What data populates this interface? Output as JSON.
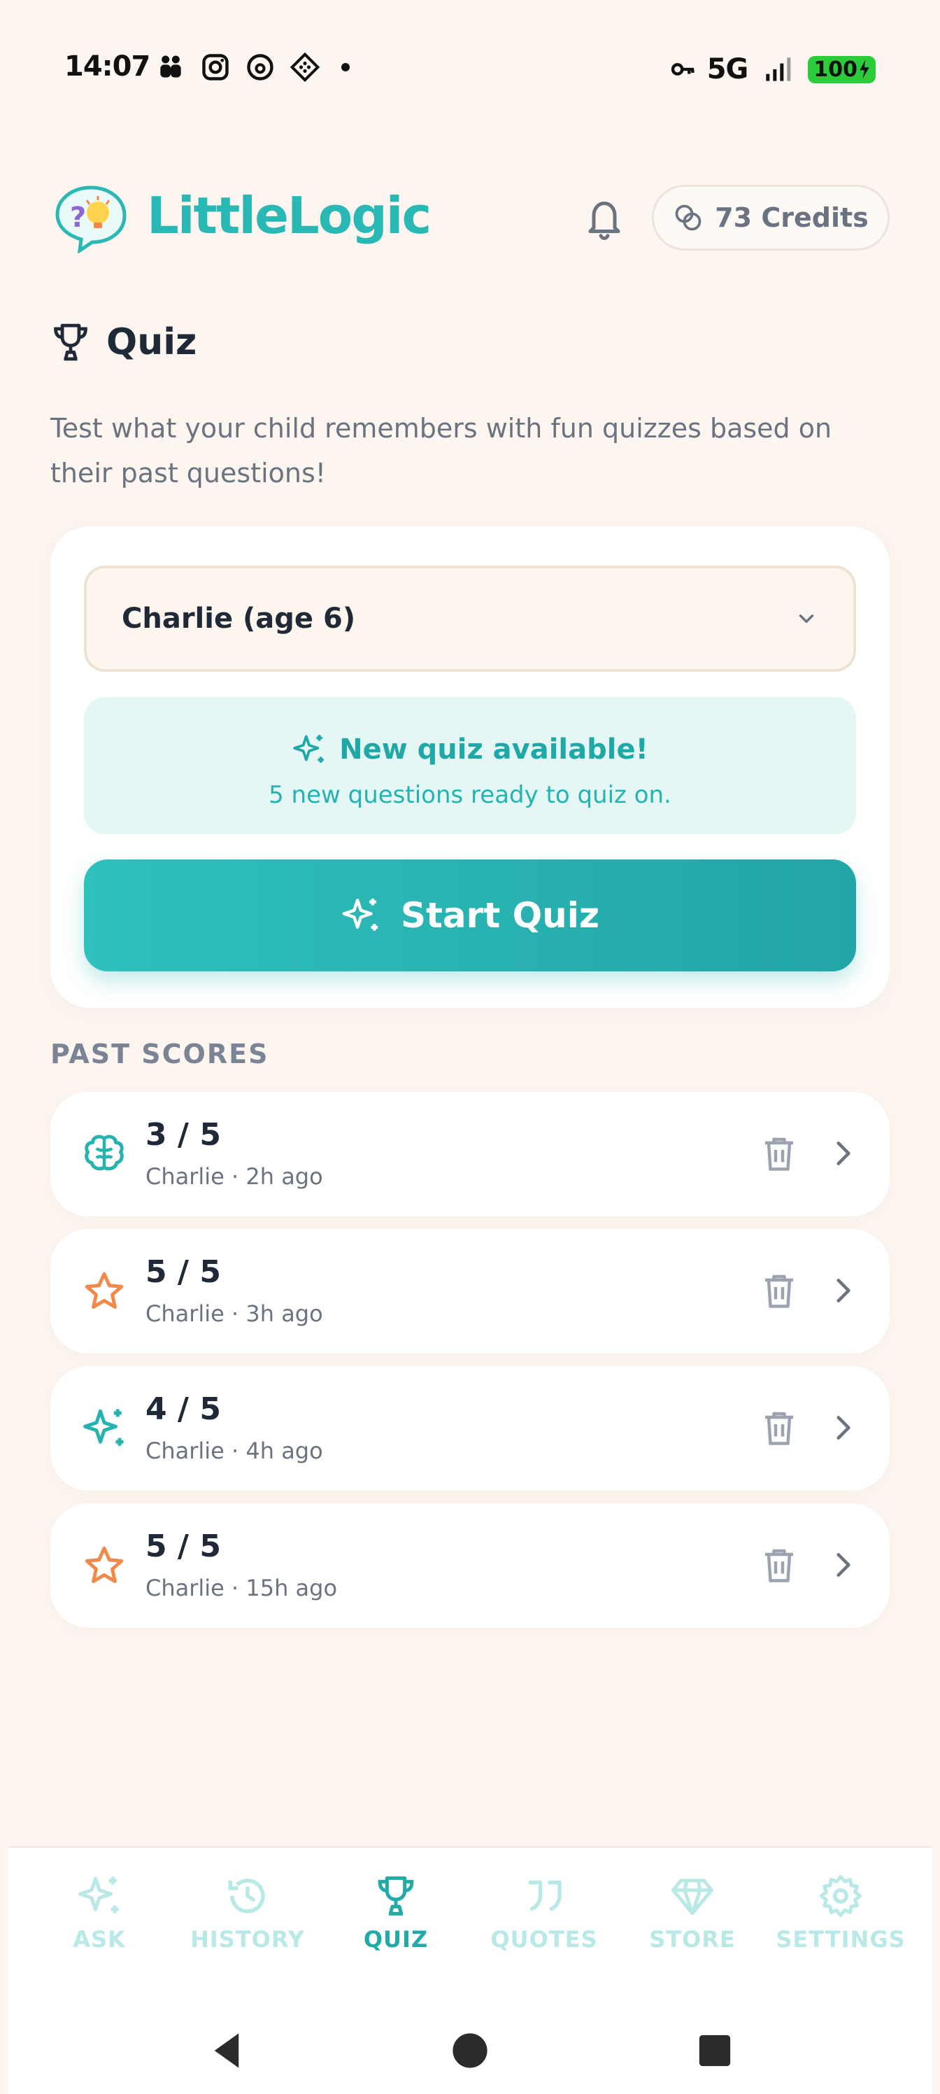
{
  "status_bar": {
    "time": "14:07",
    "network": "5G",
    "battery": "100"
  },
  "header": {
    "app_name": "LittleLogic",
    "credits_label": "73 Credits"
  },
  "page": {
    "title": "Quiz",
    "description": "Test what your child remembers with fun quizzes based on their past questions!"
  },
  "quiz_card": {
    "selected_child": "Charlie (age 6)",
    "notice_title": "New quiz available!",
    "notice_subtitle": "5 new questions ready to quiz on.",
    "start_button_label": "Start Quiz"
  },
  "past_scores": {
    "section_label": "PAST SCORES",
    "items": [
      {
        "score": "3 / 5",
        "meta": "Charlie · 2h ago",
        "icon": "brain-icon"
      },
      {
        "score": "5 / 5",
        "meta": "Charlie · 3h ago",
        "icon": "star-icon"
      },
      {
        "score": "4 / 5",
        "meta": "Charlie · 4h ago",
        "icon": "sparkle-icon"
      },
      {
        "score": "5 / 5",
        "meta": "Charlie · 15h ago",
        "icon": "star-icon"
      }
    ]
  },
  "bottom_nav": {
    "items": [
      {
        "label": "ASK",
        "icon": "sparkle-icon",
        "active": false
      },
      {
        "label": "HISTORY",
        "icon": "history-icon",
        "active": false
      },
      {
        "label": "QUIZ",
        "icon": "trophy-icon",
        "active": true
      },
      {
        "label": "QUOTES",
        "icon": "quote-icon",
        "active": false
      },
      {
        "label": "STORE",
        "icon": "diamond-icon",
        "active": false
      },
      {
        "label": "SETTINGS",
        "icon": "gear-icon",
        "active": false
      }
    ]
  },
  "colors": {
    "brand": "#2ab8b5",
    "background": "#fdf6f0",
    "accent_orange": "#f08a4b",
    "nav_inactive": "#b8e9e6"
  }
}
